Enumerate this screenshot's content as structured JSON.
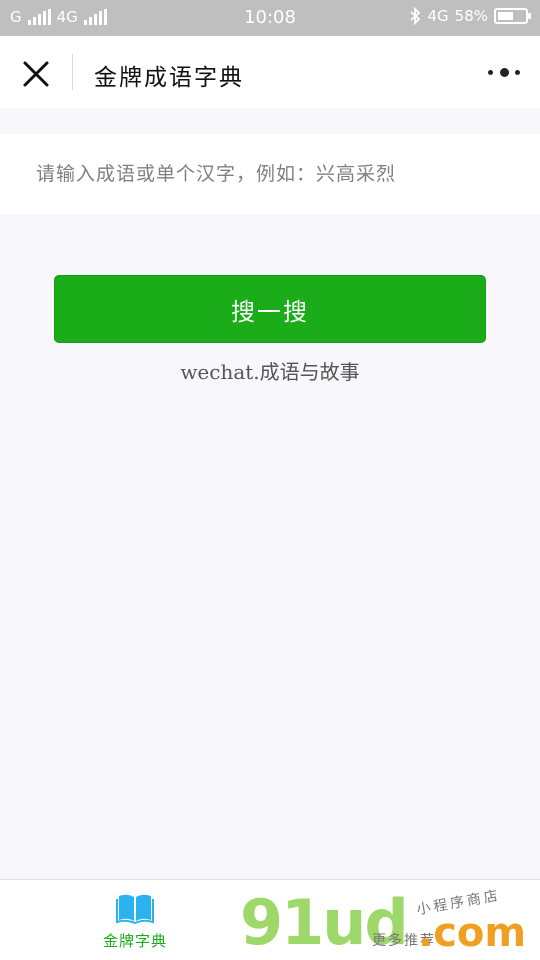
{
  "status_bar": {
    "carrier1": "G",
    "carrier2": "4G",
    "time": "10:08",
    "network": "4G",
    "battery": "58%",
    "battery_level": 0.58
  },
  "header": {
    "title": "金牌成语字典"
  },
  "search": {
    "placeholder": "请输入成语或单个汉字，例如：兴高采烈"
  },
  "search_button": {
    "label": "搜一搜"
  },
  "caption": "wechat.成语与故事",
  "tab_bar": {
    "items": [
      {
        "label": "金牌字典",
        "icon": "book-icon",
        "active": true,
        "color": "#1aad19"
      }
    ]
  },
  "watermark": {
    "logo": "91ud",
    "dotcom": ".com",
    "line1": "小程序商店",
    "line2": "更多推荐"
  },
  "colors": {
    "accent": "#1aad19",
    "icon_blue": "#2bb3f0",
    "status_bar": "#bfbfbf"
  }
}
